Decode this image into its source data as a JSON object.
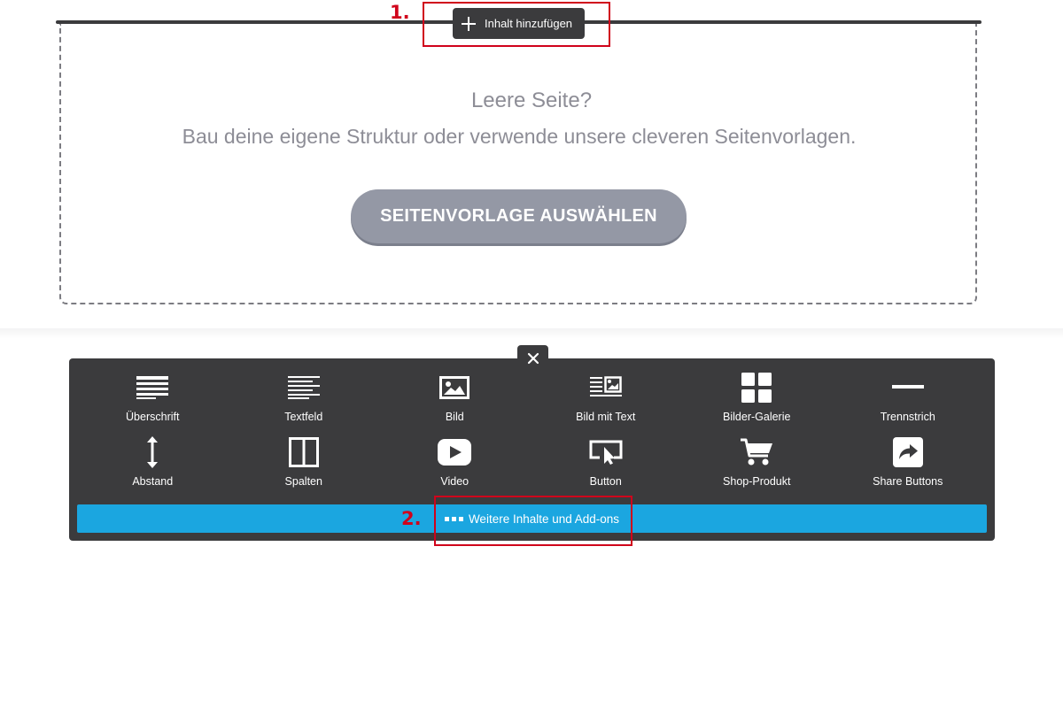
{
  "editor": {
    "add_content_label": "Inhalt hinzufügen",
    "empty_title": "Leere Seite?",
    "empty_subtitle": "Bau deine eigene Struktur oder verwende unsere cleveren Seitenvorlagen.",
    "template_button": "SEITENVORLAGE AUSWÄHLEN"
  },
  "annotations": {
    "step1": "1.",
    "step2": "2."
  },
  "panel": {
    "items": [
      {
        "label": "Überschrift",
        "icon": "heading-icon"
      },
      {
        "label": "Textfeld",
        "icon": "text-icon"
      },
      {
        "label": "Bild",
        "icon": "image-icon"
      },
      {
        "label": "Bild mit Text",
        "icon": "image-text-icon"
      },
      {
        "label": "Bilder-Galerie",
        "icon": "gallery-icon"
      },
      {
        "label": "Trennstrich",
        "icon": "divider-icon"
      },
      {
        "label": "Abstand",
        "icon": "spacing-icon"
      },
      {
        "label": "Spalten",
        "icon": "columns-icon"
      },
      {
        "label": "Video",
        "icon": "video-icon"
      },
      {
        "label": "Button",
        "icon": "button-icon"
      },
      {
        "label": "Shop-Produkt",
        "icon": "cart-icon"
      },
      {
        "label": "Share Buttons",
        "icon": "share-icon"
      }
    ],
    "more_label": "Weitere Inhalte und Add-ons"
  },
  "colors": {
    "panel_bg": "#3b3b3d",
    "more_bar": "#1ba6e0",
    "annotation": "#d0021b",
    "template_button": "#9498a5"
  }
}
